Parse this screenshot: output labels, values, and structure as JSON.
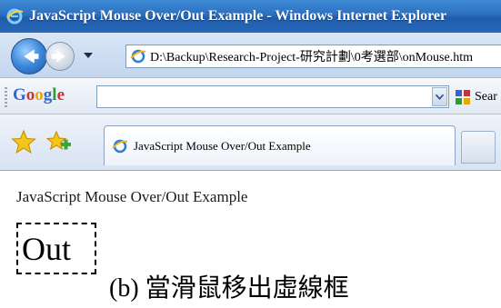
{
  "window": {
    "title": "JavaScript Mouse Over/Out Example - Windows Internet Explorer"
  },
  "address_bar": {
    "url": "D:\\Backup\\Research-Project-研究計劃\\0考選部\\onMouse.htm"
  },
  "google_toolbar": {
    "logo": "Google",
    "search_value": "",
    "search_button_label": "Sear"
  },
  "favorites_bar": {
    "tab_title": "JavaScript Mouse Over/Out Example"
  },
  "page": {
    "heading": "JavaScript Mouse Over/Out Example",
    "box_text": "Out",
    "caption": "(b)  當滑鼠移出虛線框"
  },
  "colors": {
    "titlebar": "#2b6fc0",
    "google_blue": "#3366cc",
    "google_red": "#cc3333",
    "google_yellow": "#e6a800",
    "google_green": "#2f9a3a"
  },
  "icons": {
    "title": "ie-icon",
    "back": "back-arrow-icon",
    "forward": "forward-arrow-icon",
    "history": "dropdown-arrow-icon",
    "page": "ie-page-icon",
    "favorites": "favorites-star-icon",
    "add_favorites": "add-favorites-icon",
    "google_search": "google-search-icon"
  }
}
